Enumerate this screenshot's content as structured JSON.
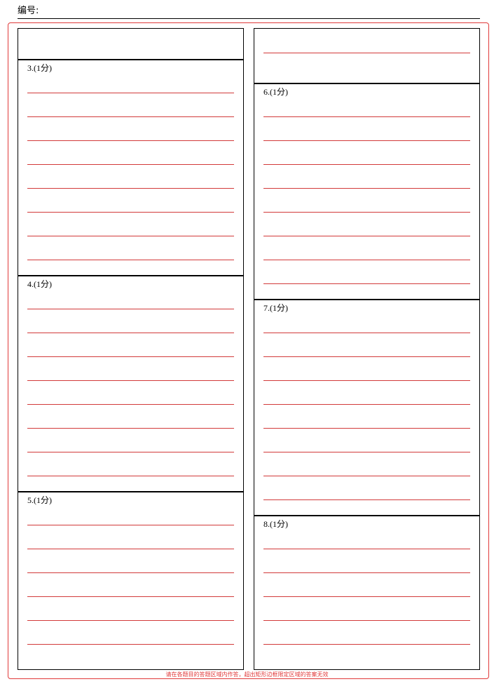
{
  "header": {
    "label": "编号:"
  },
  "sections": {
    "q3": {
      "title": "3.(1分)"
    },
    "q4": {
      "title": "4.(1分)"
    },
    "q5": {
      "title": "5.(1分)"
    },
    "q6": {
      "title": "6.(1分)"
    },
    "q7": {
      "title": "7.(1分)"
    },
    "q8": {
      "title": "8.(1分)"
    }
  },
  "footer": {
    "note": "请在各题目的答题区域内作答，超出矩形边框限定区域的答案无效"
  },
  "colors": {
    "frame": "#e03a3a",
    "answer_line": "#d23a3a",
    "border": "#000000"
  }
}
